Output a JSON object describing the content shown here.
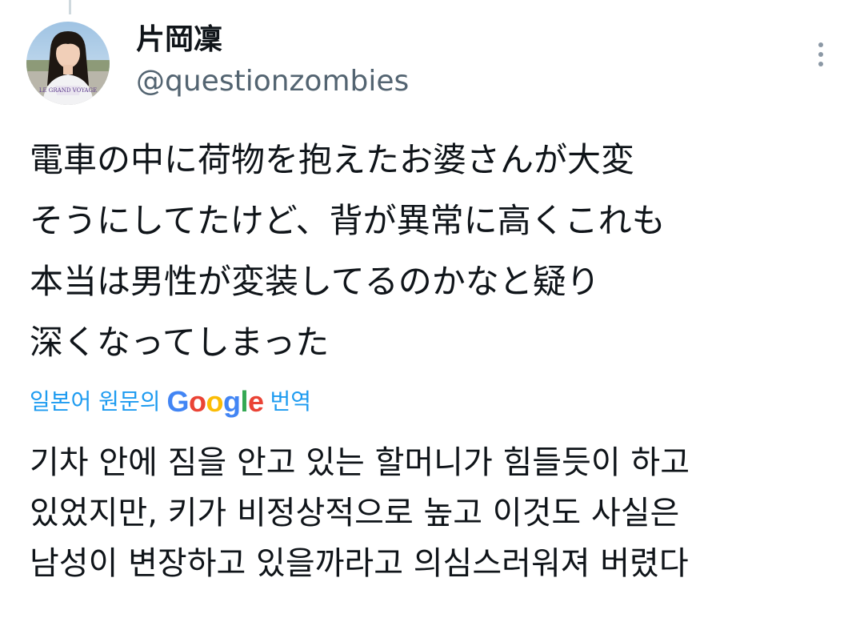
{
  "author": {
    "display_name": "片岡凜",
    "handle": "@questionzombies",
    "avatar_icon": "profile-photo",
    "avatar_shirt_text": "LE GRAND VOYAGE"
  },
  "more_icon": "more-vertical-icon",
  "tweet": {
    "lines": [
      "電車の中に荷物を抱えたお婆さんが大変",
      "そうにしてたけど、背が異常に高くこれも",
      "本当は男性が変装してるのかなと疑り",
      "深くなってしまった"
    ]
  },
  "translation": {
    "label_before": "일본어 원문의",
    "label_logo": "Google",
    "label_after": "번역",
    "lines": [
      "기차 안에 짐을 안고 있는 할머니가 힘들듯이 하고",
      "있었지만, 키가 비정상적으로 높고 이것도 사실은",
      "남성이 변장하고 있을까라고 의심스러워져 버렸다"
    ]
  },
  "colors": {
    "link": "#1d9bf0",
    "text": "#0f1419",
    "secondary": "#536471"
  }
}
